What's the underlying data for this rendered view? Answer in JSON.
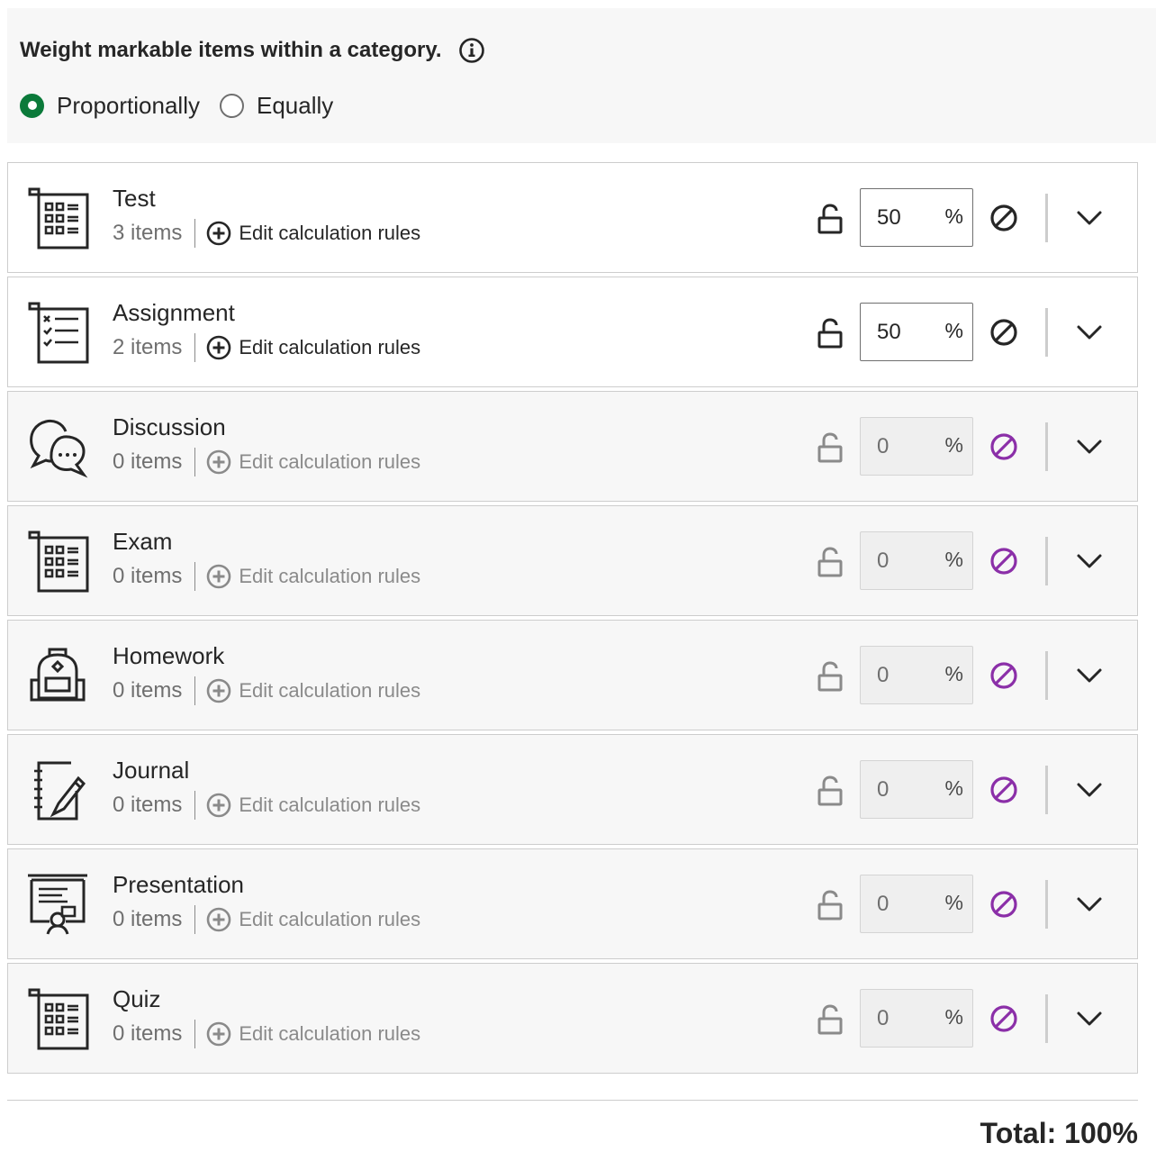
{
  "weighting": {
    "heading": "Weight markable items within a category.",
    "info_icon": "info-icon",
    "options": [
      {
        "label": "Proportionally",
        "checked": true
      },
      {
        "label": "Equally",
        "checked": false
      }
    ]
  },
  "colors": {
    "radio_selected": "#0b7a3a",
    "exclude_active": "#8b2fa8",
    "text": "#262626",
    "muted": "#6f6f6f"
  },
  "categories": [
    {
      "name": "Test",
      "items": "3 items",
      "edit": "Edit calculation rules",
      "weight": "50",
      "unit": "%",
      "icon": "test-icon",
      "enabled": true
    },
    {
      "name": "Assignment",
      "items": "2 items",
      "edit": "Edit calculation rules",
      "weight": "50",
      "unit": "%",
      "icon": "assignment-icon",
      "enabled": true
    },
    {
      "name": "Discussion",
      "items": "0 items",
      "edit": "Edit calculation rules",
      "weight": "0",
      "unit": "%",
      "icon": "discussion-icon",
      "enabled": false
    },
    {
      "name": "Exam",
      "items": "0 items",
      "edit": "Edit calculation rules",
      "weight": "0",
      "unit": "%",
      "icon": "exam-icon",
      "enabled": false
    },
    {
      "name": "Homework",
      "items": "0 items",
      "edit": "Edit calculation rules",
      "weight": "0",
      "unit": "%",
      "icon": "backpack-icon",
      "enabled": false
    },
    {
      "name": "Journal",
      "items": "0 items",
      "edit": "Edit calculation rules",
      "weight": "0",
      "unit": "%",
      "icon": "journal-icon",
      "enabled": false
    },
    {
      "name": "Presentation",
      "items": "0 items",
      "edit": "Edit calculation rules",
      "weight": "0",
      "unit": "%",
      "icon": "presentation-icon",
      "enabled": false
    },
    {
      "name": "Quiz",
      "items": "0 items",
      "edit": "Edit calculation rules",
      "weight": "0",
      "unit": "%",
      "icon": "quiz-icon",
      "enabled": false
    }
  ],
  "total": "Total: 100%"
}
